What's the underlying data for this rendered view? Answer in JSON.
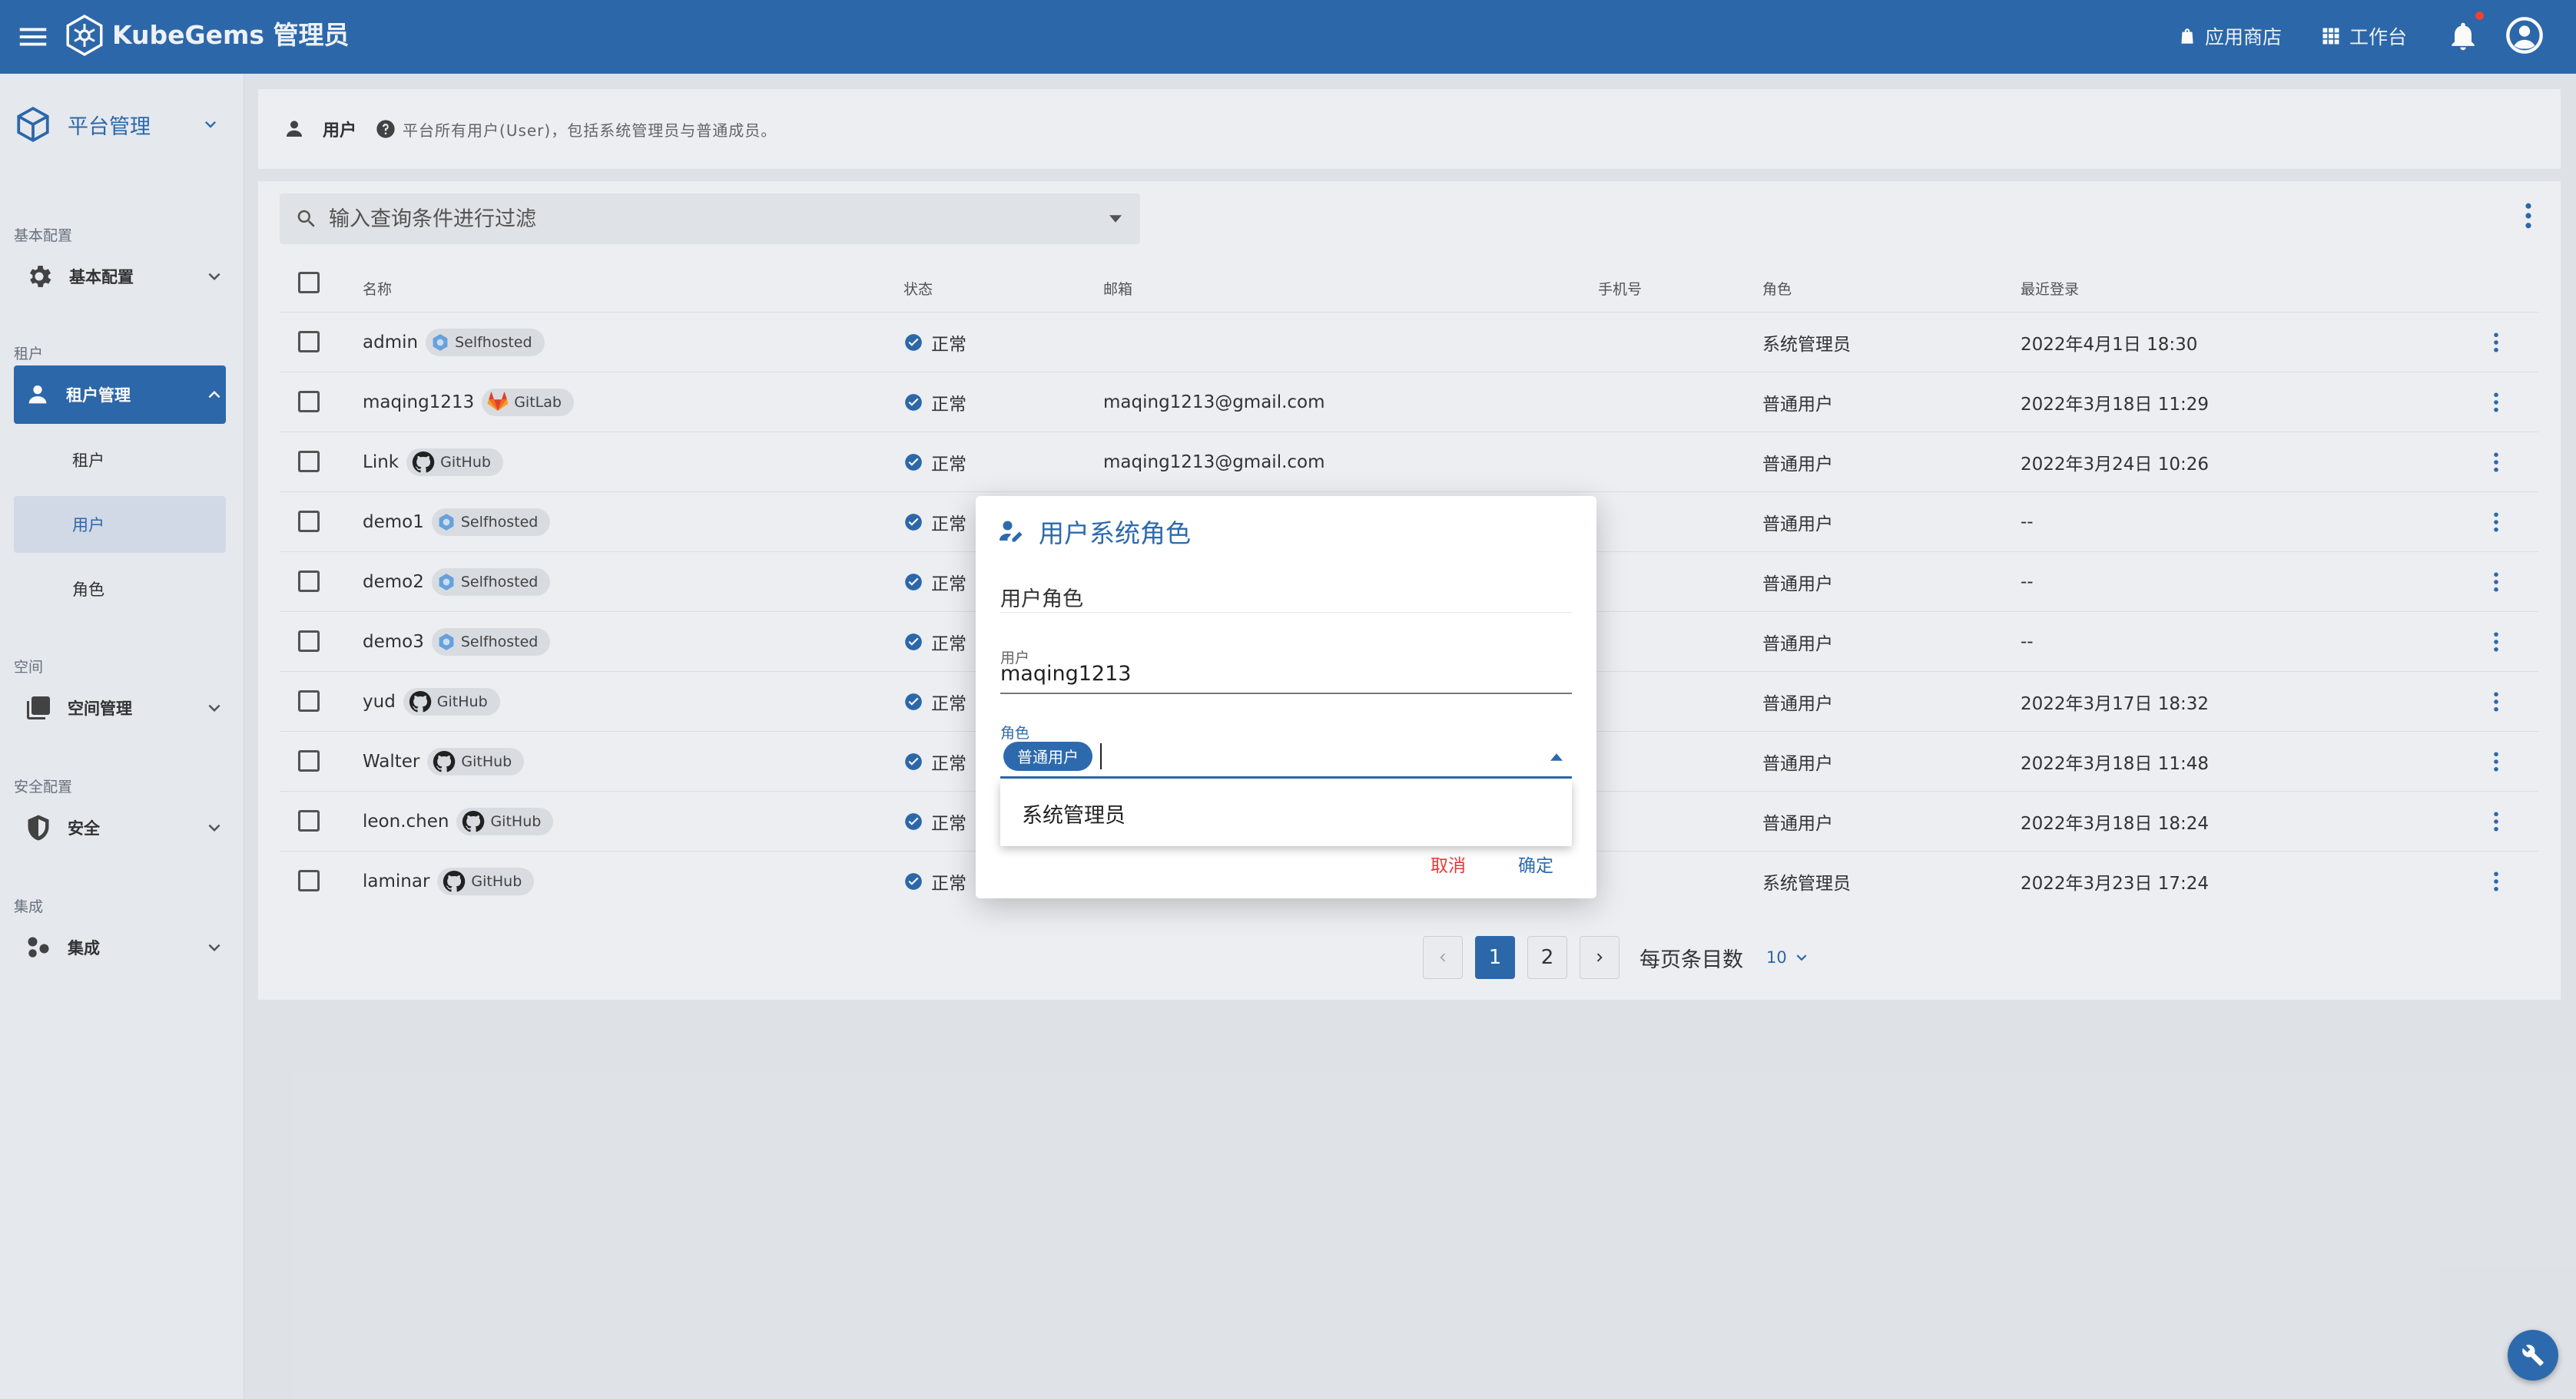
{
  "header": {
    "brand": "KubeGems 管理员",
    "app_store": "应用商店",
    "workspace": "工作台",
    "colors": {
      "primary": "#2d6aad",
      "danger": "#f44336"
    }
  },
  "sidebar": {
    "platform": "平台管理",
    "sections": {
      "basic": "基本配置",
      "tenant": "租户",
      "space": "空间",
      "security": "安全配置",
      "integration": "集成"
    },
    "items": {
      "basic_config": "基本配置",
      "tenant_mgmt": "租户管理",
      "tenant": "租户",
      "user": "用户",
      "role": "角色",
      "space_mgmt": "空间管理",
      "security": "安全",
      "integration": "集成"
    }
  },
  "page": {
    "title": "用户",
    "description": "平台所有用户(User)，包括系统管理员与普通成员。"
  },
  "search": {
    "placeholder": "输入查询条件进行过滤"
  },
  "table": {
    "headers": {
      "name": "名称",
      "status": "状态",
      "email": "邮箱",
      "phone": "手机号",
      "role": "角色",
      "last_login": "最近登录"
    },
    "rows": [
      {
        "name": "admin",
        "source": "Selfhosted",
        "status": "正常",
        "email": "",
        "role": "系统管理员",
        "last_login": "2022年4月1日 18:30"
      },
      {
        "name": "maqing1213",
        "source": "GitLab",
        "status": "正常",
        "email": "maqing1213@gmail.com",
        "role": "普通用户",
        "last_login": "2022年3月18日 11:29"
      },
      {
        "name": "Link",
        "source": "GitHub",
        "status": "正常",
        "email": "maqing1213@gmail.com",
        "role": "普通用户",
        "last_login": "2022年3月24日 10:26"
      },
      {
        "name": "demo1",
        "source": "Selfhosted",
        "status": "正常",
        "email": "",
        "role": "普通用户",
        "last_login": "--"
      },
      {
        "name": "demo2",
        "source": "Selfhosted",
        "status": "正常",
        "email": "",
        "role": "普通用户",
        "last_login": "--"
      },
      {
        "name": "demo3",
        "source": "Selfhosted",
        "status": "正常",
        "email": "",
        "role": "普通用户",
        "last_login": "--"
      },
      {
        "name": "yud",
        "source": "GitHub",
        "status": "正常",
        "email": "",
        "role": "普通用户",
        "last_login": "2022年3月17日 18:32"
      },
      {
        "name": "Walter",
        "source": "GitHub",
        "status": "正常",
        "email": "",
        "role": "普通用户",
        "last_login": "2022年3月18日 11:48"
      },
      {
        "name": "leon.chen",
        "source": "GitHub",
        "status": "正常",
        "email": "",
        "role": "普通用户",
        "last_login": "2022年3月18日 18:24"
      },
      {
        "name": "laminar",
        "source": "GitHub",
        "status": "正常",
        "email": "",
        "role": "系统管理员",
        "last_login": "2022年3月23日 17:24"
      }
    ]
  },
  "pagination": {
    "pages": [
      "1",
      "2"
    ],
    "current": "1",
    "per_page_label": "每页条目数",
    "per_page_value": "10"
  },
  "dialog": {
    "title": "用户系统角色",
    "section": "用户角色",
    "user_label": "用户",
    "user_value": "maqing1213",
    "role_label": "角色",
    "role_selected": "普通用户",
    "role_option": "系统管理员",
    "cancel": "取消",
    "confirm": "确定"
  }
}
